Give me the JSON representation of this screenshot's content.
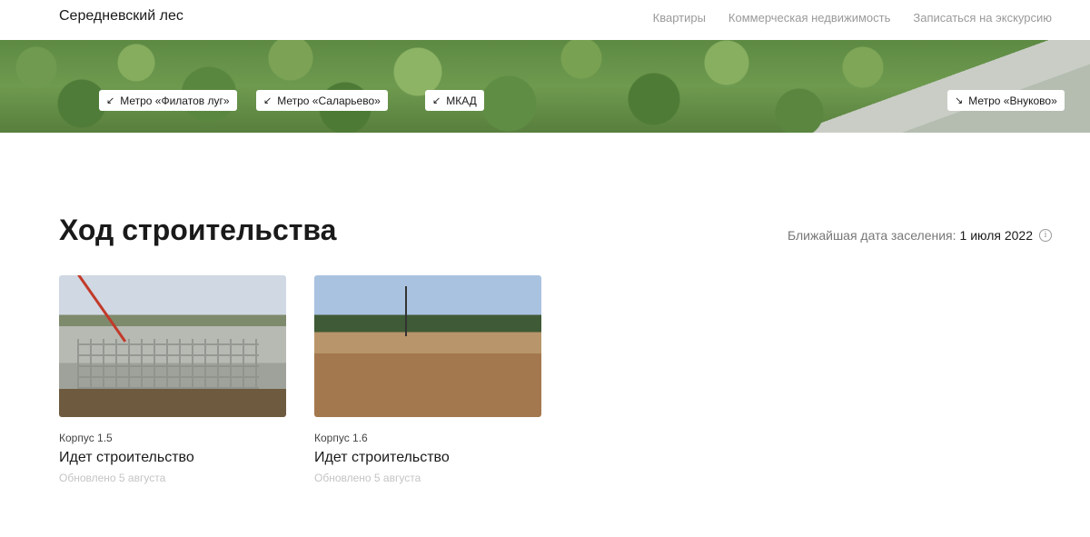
{
  "header": {
    "logo": "Середневский лес",
    "nav": [
      "Квартиры",
      "Коммерческая недвижимость",
      "Записаться на экскурсию"
    ]
  },
  "banner": {
    "tags": [
      {
        "icon": "arrow-down-left-icon",
        "glyph": "↙",
        "label": "Метро «Филатов луг»"
      },
      {
        "icon": "arrow-down-left-icon",
        "glyph": "↙",
        "label": "Метро «Саларьево»"
      },
      {
        "icon": "arrow-down-left-icon",
        "glyph": "↙",
        "label": "МКАД"
      },
      {
        "icon": "arrow-down-right-icon",
        "glyph": "↘",
        "label": "Метро «Внуково»"
      }
    ]
  },
  "construction": {
    "title": "Ход строительства",
    "settlement_label": "Ближайшая дата заселения:",
    "settlement_date": "1 июля 2022",
    "info_glyph": "i",
    "cards": [
      {
        "corpus": "Корпус 1.5",
        "status": "Идет строительство",
        "updated": "Обновлено 5 августа"
      },
      {
        "corpus": "Корпус 1.6",
        "status": "Идет строительство",
        "updated": "Обновлено 5 августа"
      }
    ]
  }
}
